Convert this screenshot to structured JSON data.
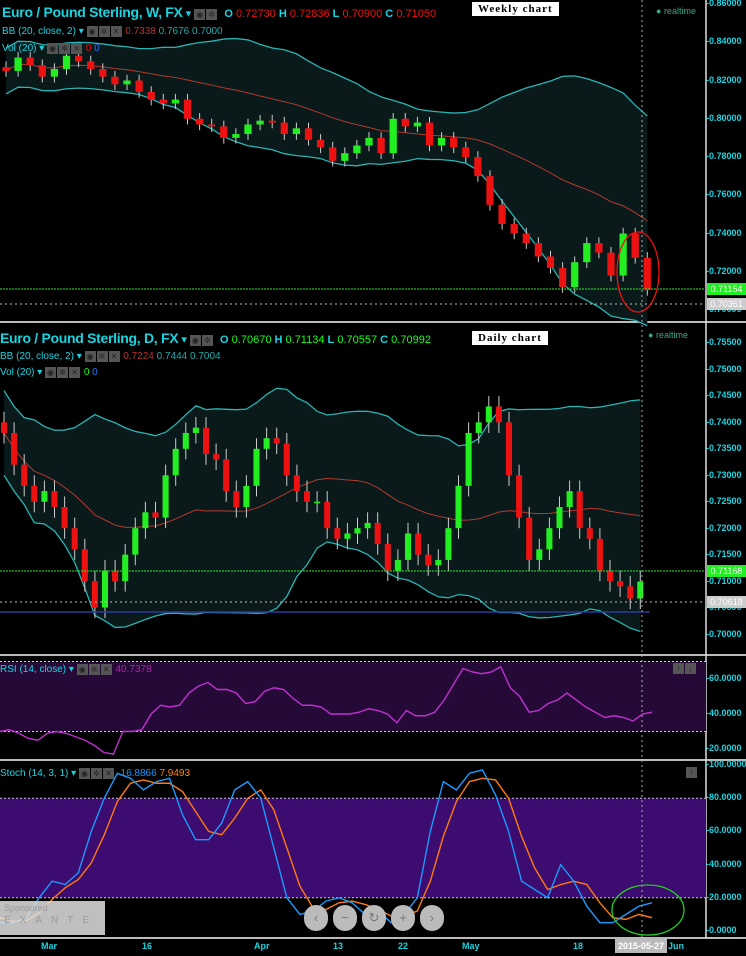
{
  "weekly": {
    "title": "Euro / Pound Sterling, W, FX",
    "o_label": "O",
    "o": "0.72730",
    "h_label": "H",
    "h": "0.72836",
    "l_label": "L",
    "l": "0.70900",
    "c_label": "C",
    "c": "0.71050",
    "bb_label": "BB (20, close, 2)",
    "bb_values": [
      "0.7338",
      "0.7676",
      "0.7000"
    ],
    "vol_label": "Vol (20)",
    "vol_values": [
      "0",
      "0"
    ],
    "annotation": "Weekly chart",
    "realtime": "realtime",
    "price_badge": "0.71154",
    "line_badge": "0.70351",
    "ticks": [
      "0.86000",
      "0.84000",
      "0.82000",
      "0.80000",
      "0.78000",
      "0.76000",
      "0.74000",
      "0.72000",
      "0.70000"
    ]
  },
  "daily": {
    "title": "Euro / Pound Sterling, D, FX",
    "o_label": "O",
    "o": "0.70670",
    "h_label": "H",
    "h": "0.71134",
    "l_label": "L",
    "l": "0.70557",
    "c_label": "C",
    "c": "0.70992",
    "bb_label": "BB (20, close, 2)",
    "bb_values": [
      "0.7224",
      "0.7444",
      "0.7004"
    ],
    "vol_label": "Vol (20)",
    "vol_values": [
      "0",
      "0"
    ],
    "annotation": "Daily chart",
    "realtime": "realtime",
    "price_badge": "0.71168",
    "line_badge": "0.70618",
    "ticks": [
      "0.75500",
      "0.75000",
      "0.74500",
      "0.74000",
      "0.73500",
      "0.73000",
      "0.72500",
      "0.72000",
      "0.71500",
      "0.71000",
      "0.70500",
      "0.70000"
    ]
  },
  "rsi": {
    "label": "RSI (14, close)",
    "value": "40.7378",
    "ticks": [
      "60.0000",
      "40.0000",
      "20.0000"
    ]
  },
  "stoch": {
    "label": "Stoch (14, 3, 1)",
    "k": "16.8866",
    "d": "7.9493",
    "ticks": [
      "100.0000",
      "80.0000",
      "60.0000",
      "40.0000",
      "20.0000",
      "0.0000"
    ]
  },
  "xaxis": {
    "labels": [
      "Mar",
      "16",
      "Apr",
      "13",
      "22",
      "May",
      "18"
    ],
    "cursor_date": "2015-05-27",
    "tail": "Jun"
  },
  "sponsor": {
    "label": "Sponsored",
    "brand": "EXANTE"
  },
  "nav": [
    "‹",
    "−",
    "↻",
    "+",
    "›"
  ],
  "colors": {
    "up": "#22ee22",
    "down": "#ee1111",
    "band": "#2ab3b3",
    "mid": "#b03a2e",
    "rsi": "#c030d0",
    "k": "#1a9aff",
    "d": "#ff7a10",
    "band_fill": "#0a1a1a"
  },
  "chart_data": [
    {
      "type": "candlestick",
      "name": "weekly",
      "ylim": [
        0.7,
        0.86
      ],
      "closes": [
        0.825,
        0.832,
        0.828,
        0.822,
        0.826,
        0.833,
        0.83,
        0.826,
        0.822,
        0.818,
        0.82,
        0.814,
        0.81,
        0.808,
        0.81,
        0.8,
        0.797,
        0.796,
        0.79,
        0.792,
        0.797,
        0.799,
        0.798,
        0.792,
        0.795,
        0.789,
        0.785,
        0.778,
        0.782,
        0.786,
        0.79,
        0.782,
        0.8,
        0.796,
        0.798,
        0.786,
        0.79,
        0.785,
        0.78,
        0.77,
        0.755,
        0.745,
        0.74,
        0.735,
        0.728,
        0.722,
        0.712,
        0.725,
        0.735,
        0.73,
        0.718,
        0.74,
        0.7273,
        0.7105
      ]
    },
    {
      "type": "candlestick",
      "name": "daily",
      "ylim": [
        0.7,
        0.755
      ],
      "closes": [
        0.738,
        0.732,
        0.728,
        0.725,
        0.727,
        0.724,
        0.72,
        0.716,
        0.71,
        0.705,
        0.712,
        0.71,
        0.715,
        0.72,
        0.723,
        0.722,
        0.73,
        0.735,
        0.738,
        0.739,
        0.734,
        0.733,
        0.727,
        0.724,
        0.728,
        0.735,
        0.737,
        0.736,
        0.73,
        0.727,
        0.725,
        0.725,
        0.72,
        0.718,
        0.719,
        0.72,
        0.721,
        0.717,
        0.712,
        0.714,
        0.719,
        0.715,
        0.713,
        0.714,
        0.72,
        0.728,
        0.738,
        0.74,
        0.743,
        0.74,
        0.73,
        0.722,
        0.714,
        0.716,
        0.72,
        0.724,
        0.727,
        0.72,
        0.718,
        0.712,
        0.71,
        0.709,
        0.7067,
        0.7099
      ]
    },
    {
      "type": "line",
      "name": "rsi",
      "ylim": [
        15,
        75
      ],
      "bands": [
        30,
        70
      ],
      "values": [
        30,
        31,
        29,
        26,
        25,
        29,
        30,
        29,
        27,
        25,
        22,
        18,
        17,
        30,
        30,
        31,
        40,
        45,
        44,
        45,
        52,
        56,
        58,
        54,
        54,
        52,
        46,
        47,
        53,
        55,
        54,
        49,
        45,
        45,
        44,
        40,
        40,
        40,
        41,
        43,
        42,
        40,
        35,
        42,
        39,
        39,
        41,
        48,
        57,
        66,
        64,
        63,
        64,
        67,
        55,
        50,
        41,
        42,
        46,
        48,
        52,
        48,
        44,
        41,
        38,
        39,
        38,
        36,
        40,
        41
      ]
    },
    {
      "type": "line",
      "name": "stoch",
      "ylim": [
        0,
        100
      ],
      "bands": [
        20,
        80
      ],
      "k": [
        5,
        5,
        8,
        20,
        30,
        28,
        35,
        60,
        80,
        95,
        92,
        85,
        90,
        92,
        70,
        55,
        55,
        65,
        85,
        90,
        80,
        50,
        20,
        10,
        12,
        18,
        20,
        17,
        10,
        12,
        5,
        10,
        20,
        60,
        90,
        85,
        95,
        97,
        82,
        60,
        30,
        25,
        20,
        40,
        30,
        15,
        5,
        5,
        10,
        15,
        17
      ],
      "d": [
        8,
        6,
        6,
        11,
        19,
        26,
        31,
        41,
        58,
        78,
        89,
        91,
        89,
        89,
        84,
        72,
        60,
        58,
        68,
        80,
        85,
        73,
        50,
        27,
        14,
        13,
        17,
        18,
        16,
        13,
        9,
        9,
        12,
        30,
        57,
        78,
        90,
        92,
        91,
        80,
        57,
        38,
        25,
        28,
        30,
        28,
        17,
        8,
        7,
        10,
        8
      ]
    }
  ]
}
